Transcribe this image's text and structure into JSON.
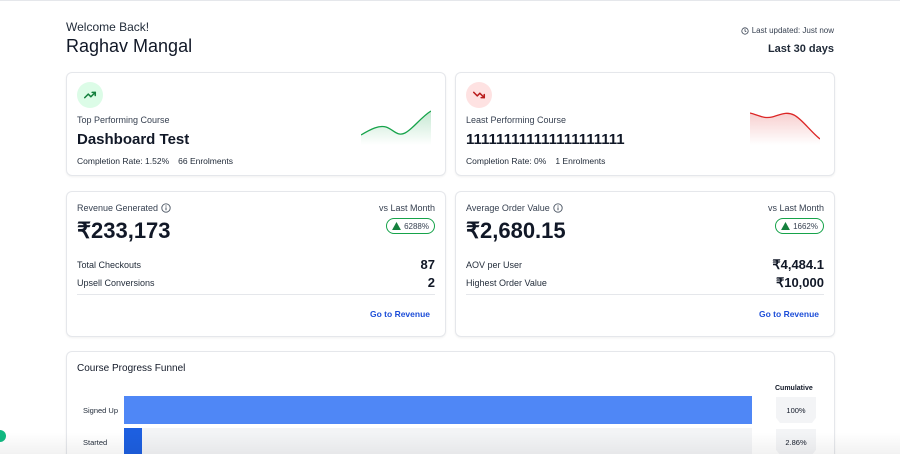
{
  "header": {
    "welcome": "Welcome Back!",
    "user_name": "Raghav Mangal",
    "last_updated": "Last updated: Just now",
    "period": "Last 30 days"
  },
  "top_course": {
    "label": "Top Performing Course",
    "name": "Dashboard Test",
    "completion": "Completion Rate: 1.52%",
    "enrolments": "66 Enrolments",
    "icon": "trending-up-icon",
    "color": "#16a34a"
  },
  "least_course": {
    "label": "Least Performing Course",
    "name": "111111111111111111111",
    "completion": "Completion Rate: 0%",
    "enrolments": "1 Enrolments",
    "icon": "trending-down-icon",
    "color": "#dc2626"
  },
  "revenue": {
    "label": "Revenue Generated",
    "vs": "vs Last Month",
    "value": "₹233,173",
    "growth": "6288%",
    "rows": [
      {
        "label": "Total Checkouts",
        "value": "87"
      },
      {
        "label": "Upsell Conversions",
        "value": "2"
      }
    ],
    "link": "Go to Revenue"
  },
  "aov": {
    "label": "Average Order Value",
    "vs": "vs Last Month",
    "value": "₹2,680.15",
    "growth": "1662%",
    "rows": [
      {
        "label": "AOV per User",
        "value": "₹4,484.1"
      },
      {
        "label": "Highest Order Value",
        "value": "₹10,000"
      }
    ],
    "link": "Go to Revenue"
  },
  "funnel": {
    "title": "Course Progress Funnel",
    "cumulative_header": "Cumulative",
    "stages": [
      {
        "label": "Signed Up",
        "cumulative": "100%",
        "fill": 1.0,
        "color": "#4f87f6"
      },
      {
        "label": "Started",
        "cumulative": "2.86%",
        "fill": 0.0286,
        "color": "#1d5fe0"
      }
    ]
  },
  "colors": {
    "accent_blue": "#1d4ed8",
    "positive": "#16a34a",
    "negative": "#dc2626"
  }
}
